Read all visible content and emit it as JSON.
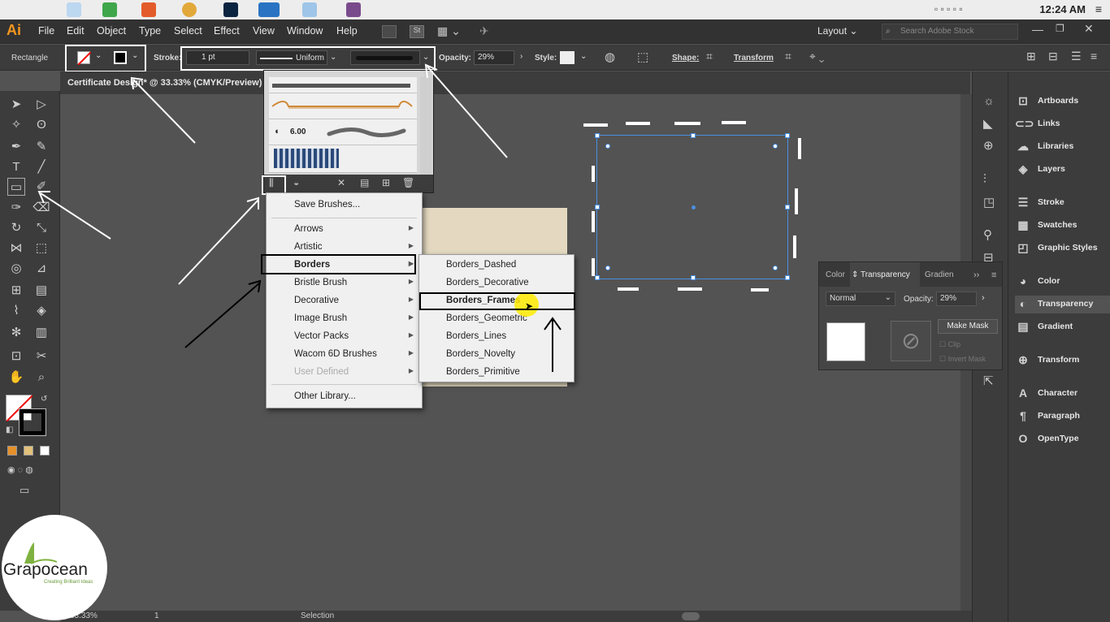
{
  "mac": {
    "clock": "12:24 AM"
  },
  "menubar": {
    "app_logo": "Ai",
    "items": [
      "File",
      "Edit",
      "Object",
      "Type",
      "Select",
      "Effect",
      "View",
      "Window",
      "Help"
    ],
    "workspace": "Layout",
    "search_placeholder": "Search Adobe Stock"
  },
  "controlbar": {
    "tool_name": "Rectangle",
    "stroke_label": "Stroke:",
    "stroke_weight": "1 pt",
    "profile": "Uniform",
    "opacity_label": "Opacity:",
    "opacity_value": "29%",
    "style_label": "Style:",
    "shape_label": "Shape:",
    "transform_label": "Transform"
  },
  "document": {
    "tab_title": "Certificate Design* @ 33.33% (CMYK/Preview)"
  },
  "status": {
    "zoom": "33.33%",
    "artboard": "1",
    "tool": "Selection"
  },
  "brush_panel": {
    "brush_size": "6.00"
  },
  "brush_menu": {
    "items": [
      {
        "label": "Save Brushes...",
        "submenu": false,
        "disabled": false
      },
      {
        "label": "Arrows",
        "submenu": true,
        "disabled": false
      },
      {
        "label": "Artistic",
        "submenu": true,
        "disabled": false
      },
      {
        "label": "Borders",
        "submenu": true,
        "disabled": false
      },
      {
        "label": "Bristle Brush",
        "submenu": true,
        "disabled": false
      },
      {
        "label": "Decorative",
        "submenu": true,
        "disabled": false
      },
      {
        "label": "Image Brush",
        "submenu": true,
        "disabled": false
      },
      {
        "label": "Vector Packs",
        "submenu": true,
        "disabled": false
      },
      {
        "label": "Wacom 6D Brushes",
        "submenu": true,
        "disabled": false
      },
      {
        "label": "User Defined",
        "submenu": true,
        "disabled": true
      },
      {
        "label": "Other Library...",
        "submenu": false,
        "disabled": false
      }
    ]
  },
  "borders_submenu": {
    "items": [
      "Borders_Dashed",
      "Borders_Decorative",
      "Borders_Frames",
      "Borders_Geometric",
      "Borders_Lines",
      "Borders_Novelty",
      "Borders_Primitive"
    ]
  },
  "transparency_panel": {
    "tabs": [
      "Color",
      "Transparency",
      "Gradien"
    ],
    "blend_mode": "Normal",
    "opacity_label": "Opacity:",
    "opacity_value": "29%",
    "make_mask": "Make Mask",
    "clip": "Clip",
    "invert_mask": "Invert Mask"
  },
  "dock_panels": {
    "items": [
      "Artboards",
      "Links",
      "Libraries",
      "Layers",
      "Stroke",
      "Swatches",
      "Graphic Styles",
      "Color",
      "Transparency",
      "Gradient",
      "Transform",
      "Character",
      "Paragraph",
      "OpenType"
    ]
  },
  "logo": {
    "name": "Grapocean",
    "tagline": "Creating Brilliant Ideas"
  }
}
